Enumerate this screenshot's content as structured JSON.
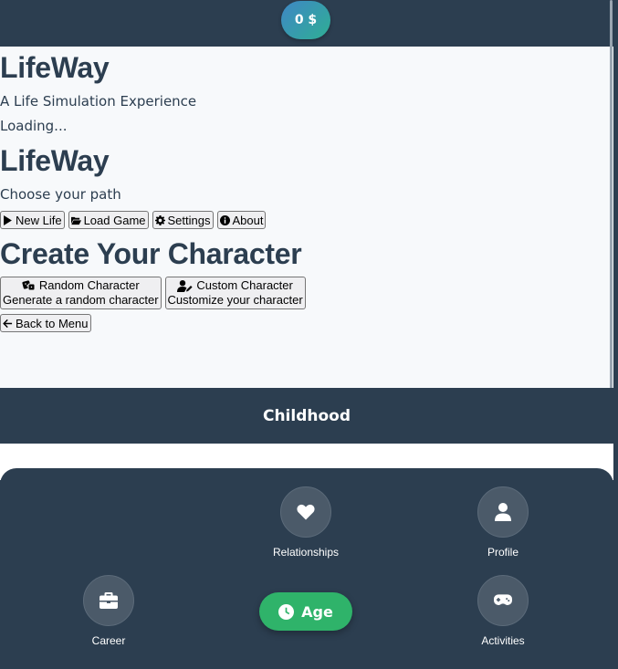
{
  "header": {
    "money": "0 $"
  },
  "splash": {
    "title": "LifeWay",
    "subtitle": "A Life Simulation Experience",
    "loading": "Loading..."
  },
  "menu": {
    "title": "LifeWay",
    "subtitle": "Choose your path",
    "buttons": {
      "new_life": "New Life",
      "load_game": "Load Game",
      "settings": "Settings",
      "about": "About"
    }
  },
  "create": {
    "title": "Create Your Character",
    "random": {
      "label": "Random Character",
      "desc": "Generate a random character"
    },
    "custom": {
      "label": "Custom Character",
      "desc": "Customize your character"
    },
    "back": "Back to Menu"
  },
  "stage": {
    "label": "Childhood"
  },
  "nav": {
    "relationships": "Relationships",
    "profile": "Profile",
    "career": "Career",
    "activities": "Activities",
    "age": "Age"
  },
  "colors": {
    "primary": "#2c3e50",
    "accent_green": "#2fb36a",
    "money_start": "#3f87c6",
    "money_end": "#2fae94"
  }
}
